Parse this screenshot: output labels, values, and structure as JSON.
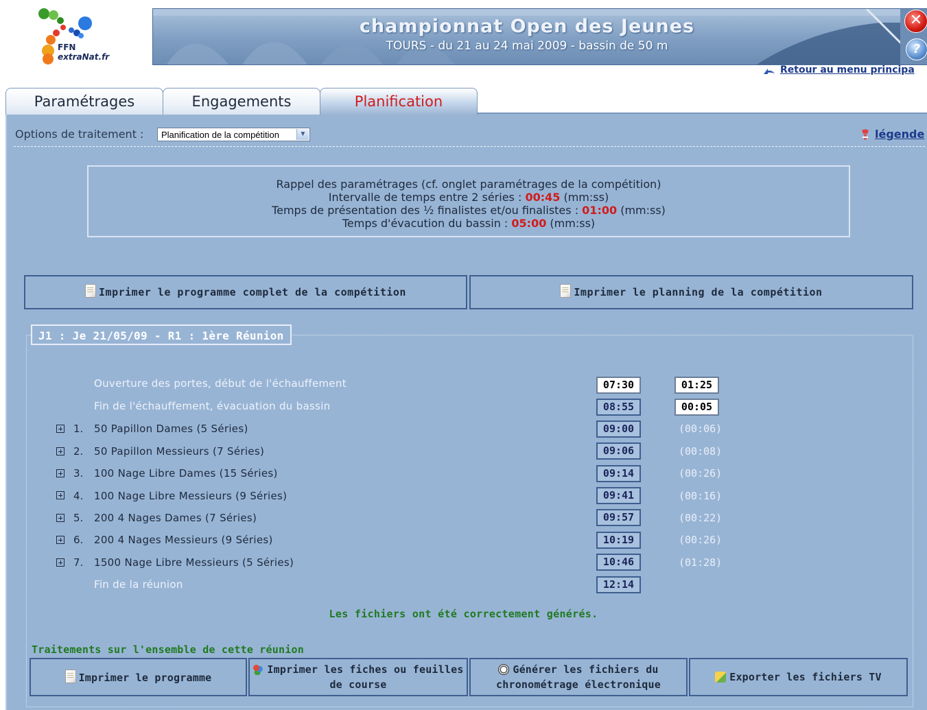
{
  "header": {
    "logo_line1": "FFN",
    "logo_line2": "extraNat.fr",
    "banner_title": "championnat Open des Jeunes",
    "banner_subtitle": "TOURS - du 21 au 24 mai 2009 - bassin de 50 m",
    "retour_label": "Retour au menu principa"
  },
  "tabs": [
    {
      "label": "Paramétrages",
      "active": false
    },
    {
      "label": "Engagements",
      "active": false
    },
    {
      "label": "Planification",
      "active": true
    }
  ],
  "options": {
    "label": "Options de traitement :",
    "selected": "Planification de la compétition",
    "legende_label": "légende"
  },
  "rappel": {
    "title": "Rappel des paramétrages (cf. onglet paramétrages de la compétition)",
    "line1_prefix": "Intervalle de temps entre 2 séries : ",
    "line1_value": "00:45",
    "line2_prefix": "Temps de présentation des ½ finalistes et/ou finalistes : ",
    "line2_value": "01:00",
    "line3_prefix": "Temps d'évacution du bassin : ",
    "line3_value": "05:00",
    "unit": " (mm:ss)"
  },
  "print_buttons": {
    "programme_complet": "Imprimer le programme complet de la compétition",
    "planning": "Imprimer le planning de la compétition"
  },
  "reunion": {
    "title": "J1 : Je 21/05/09 - R1 : 1ère Réunion",
    "ouverture_label": "Ouverture des portes, début de l'échauffement",
    "ouverture_time": "07:30",
    "ouverture_duration": "01:25",
    "fin_echauffement_label": "Fin de l'échauffement, évacuation du bassin",
    "fin_echauffement_time": "08:55",
    "fin_echauffement_duration": "00:05",
    "events": [
      {
        "num": "1.",
        "label": "50 Papillon Dames (5 Séries)",
        "time": "09:00",
        "duration": "(00:06)"
      },
      {
        "num": "2.",
        "label": "50 Papillon Messieurs (7 Séries)",
        "time": "09:06",
        "duration": "(00:08)"
      },
      {
        "num": "3.",
        "label": "100 Nage Libre Dames (15 Séries)",
        "time": "09:14",
        "duration": "(00:26)"
      },
      {
        "num": "4.",
        "label": "100 Nage Libre Messieurs (9 Séries)",
        "time": "09:41",
        "duration": "(00:16)"
      },
      {
        "num": "5.",
        "label": "200 4 Nages Dames (7 Séries)",
        "time": "09:57",
        "duration": "(00:22)"
      },
      {
        "num": "6.",
        "label": "200 4 Nages Messieurs (9 Séries)",
        "time": "10:19",
        "duration": "(00:26)"
      },
      {
        "num": "7.",
        "label": "1500 Nage Libre Messieurs (5 Séries)",
        "time": "10:46",
        "duration": "(01:28)"
      }
    ],
    "fin_reunion_label": "Fin de la réunion",
    "fin_reunion_time": "12:14",
    "success_message": "Les fichiers ont été correctement générés.",
    "traitements_label": "Traitements sur l'ensemble de cette réunion"
  },
  "bottom_buttons": {
    "imprimer_programme": "Imprimer le programme",
    "fiches_line1": "Imprimer les fiches ou feuilles",
    "fiches_line2": "de course",
    "chrono_line1": "Générer les fichiers du",
    "chrono_line2": "chronométrage électronique",
    "export_tv": "Exporter les fichiers TV"
  },
  "colors": {
    "panel_bg": "#98b4d5",
    "accent_red": "#d11c1c",
    "success_green": "#1f7a1f",
    "button_border": "#3e5f8e"
  },
  "icons": [
    "ffn-logo",
    "close-icon",
    "help-icon",
    "back-arrow-icon",
    "legend-icon",
    "document-icon",
    "users-icon",
    "stopwatch-icon",
    "export-icon",
    "expand-plus-icon",
    "chevron-down-icon"
  ]
}
